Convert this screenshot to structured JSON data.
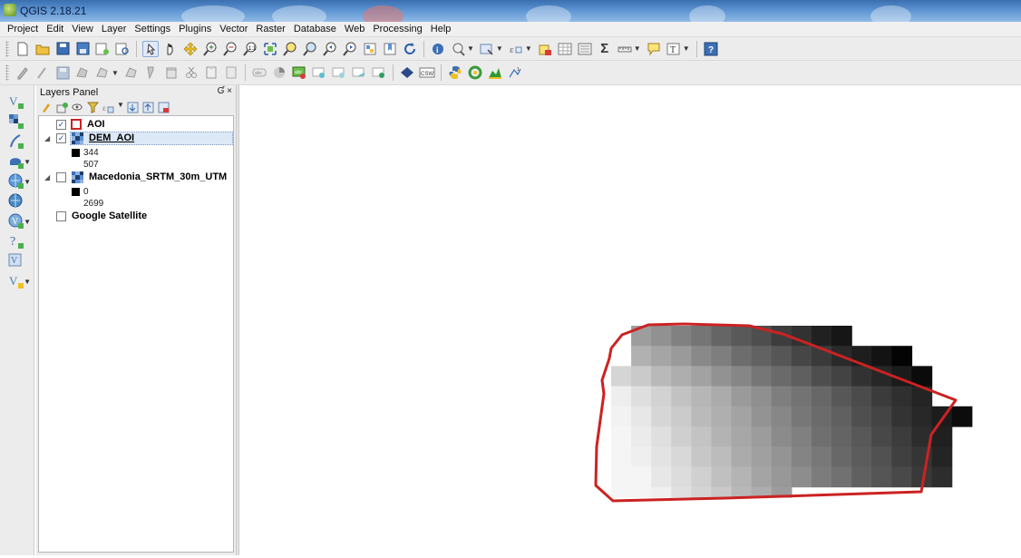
{
  "window": {
    "title": "QGIS 2.18.21"
  },
  "menu": [
    "Project",
    "Edit",
    "View",
    "Layer",
    "Settings",
    "Plugins",
    "Vector",
    "Raster",
    "Database",
    "Web",
    "Processing",
    "Help"
  ],
  "layers_panel": {
    "title": "Layers Panel",
    "controls": "Ɠ ×",
    "layers": [
      {
        "name": "AOI",
        "checked": true,
        "type": "vector-polygon"
      },
      {
        "name": "DEM_AOI",
        "checked": true,
        "type": "raster",
        "selected": true,
        "min": "344",
        "max": "507"
      },
      {
        "name": "Macedonia_SRTM_30m_UTM",
        "checked": false,
        "type": "raster",
        "min": "0",
        "max": "2699"
      },
      {
        "name": "Google Satellite",
        "checked": false,
        "type": "tile"
      }
    ]
  },
  "colors": {
    "aoi_outline": "#cc2222",
    "selection": "#dde9f7",
    "toolbar_bg": "#ececec"
  },
  "icons": [
    "new-project-icon",
    "open-project-icon",
    "save-project-icon",
    "pan-icon",
    "zoom-in-icon",
    "zoom-out-icon",
    "identify-icon",
    "sum-icon",
    "python-icon",
    "csw-icon"
  ],
  "map": {
    "raster_description": "DEM_AOI grayscale raster clipped region with AOI polygon outline"
  }
}
